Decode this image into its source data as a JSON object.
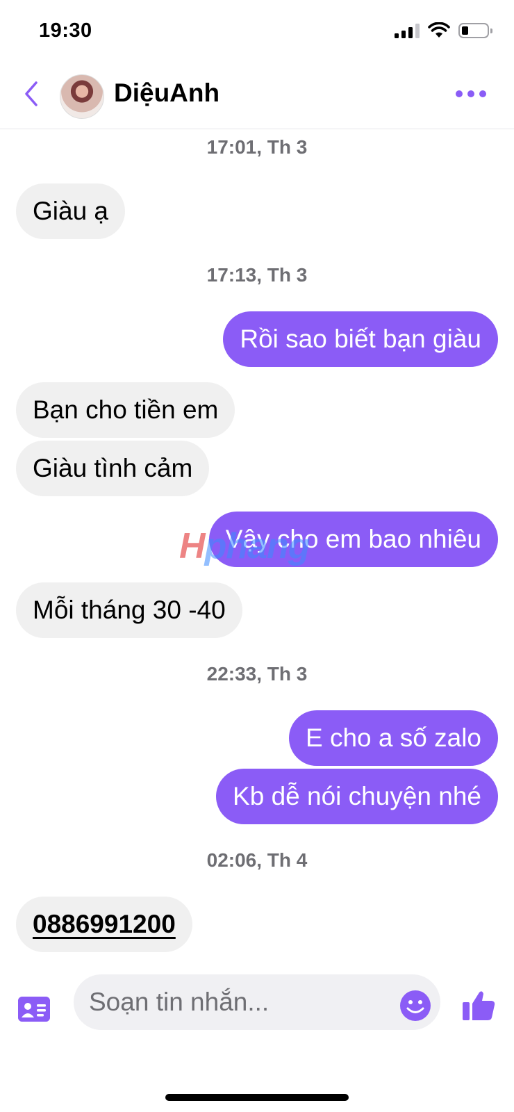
{
  "status_bar": {
    "time": "19:30"
  },
  "header": {
    "contact_name": "DiệuAnh"
  },
  "messages": [
    {
      "type": "timestamp",
      "text": "17:01, Th 3"
    },
    {
      "type": "incoming",
      "text": "Giàu ạ"
    },
    {
      "type": "timestamp",
      "text": "17:13, Th 3"
    },
    {
      "type": "outgoing",
      "text": "Rồi sao biết bạn giàu"
    },
    {
      "type": "incoming",
      "text": "Bạn cho tiền em"
    },
    {
      "type": "incoming",
      "text": "Giàu tình cảm"
    },
    {
      "type": "outgoing",
      "text": "Vậy cho em bao nhiêu"
    },
    {
      "type": "incoming",
      "text": "Mỗi tháng 30 -40"
    },
    {
      "type": "timestamp",
      "text": "22:33, Th 3"
    },
    {
      "type": "outgoing",
      "text": "E cho a số zalo"
    },
    {
      "type": "outgoing",
      "text": "Kb dễ nói chuyện nhé"
    },
    {
      "type": "timestamp",
      "text": "02:06, Th 4"
    },
    {
      "type": "incoming",
      "text": "0886991200"
    }
  ],
  "watermark": {
    "part1": "H",
    "part2": "phang"
  },
  "composer": {
    "placeholder": "Soạn tin nhắn..."
  },
  "colors": {
    "accent": "#8b5cf6",
    "incoming_bubble": "#f0f0f0"
  }
}
